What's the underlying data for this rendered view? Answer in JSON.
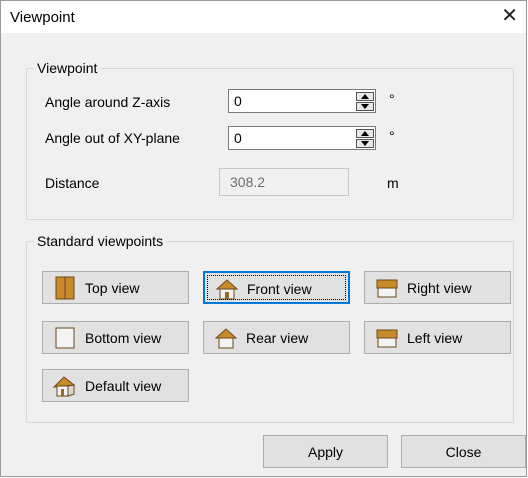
{
  "window": {
    "title": "Viewpoint",
    "close_glyph": "✕"
  },
  "viewpoint": {
    "group_label": "Viewpoint",
    "z_angle": {
      "label": "Angle around Z-axis",
      "value": "0",
      "unit": "°"
    },
    "xy_angle": {
      "label": "Angle out of XY-plane",
      "value": "0",
      "unit": "°"
    },
    "distance": {
      "label": "Distance",
      "value": "308.2",
      "unit": "m"
    }
  },
  "standard": {
    "group_label": "Standard viewpoints",
    "top": "Top view",
    "front": "Front view",
    "right": "Right view",
    "bottom": "Bottom view",
    "rear": "Rear view",
    "left": "Left view",
    "default": "Default view"
  },
  "footer": {
    "apply": "Apply",
    "close": "Close"
  },
  "colors": {
    "accent": "#0078d7",
    "roof": "#c98a2b",
    "dialog_bg": "#f0f0f0"
  }
}
